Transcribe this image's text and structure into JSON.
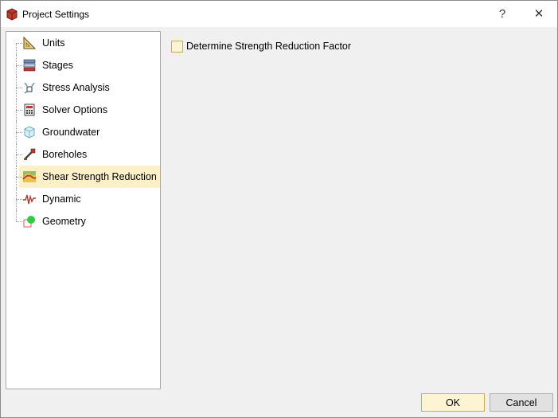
{
  "window": {
    "title": "Project Settings"
  },
  "titlebar": {
    "help_label": "?",
    "close_label": "✕"
  },
  "sidebar": {
    "items": [
      {
        "label": "Units",
        "icon": "units-icon",
        "selected": false
      },
      {
        "label": "Stages",
        "icon": "stages-icon",
        "selected": false
      },
      {
        "label": "Stress Analysis",
        "icon": "stress-analysis-icon",
        "selected": false
      },
      {
        "label": "Solver Options",
        "icon": "solver-options-icon",
        "selected": false
      },
      {
        "label": "Groundwater",
        "icon": "groundwater-icon",
        "selected": false
      },
      {
        "label": "Boreholes",
        "icon": "boreholes-icon",
        "selected": false
      },
      {
        "label": "Shear Strength Reduction",
        "icon": "shear-strength-reduction-icon",
        "selected": true
      },
      {
        "label": "Dynamic",
        "icon": "dynamic-icon",
        "selected": false
      },
      {
        "label": "Geometry",
        "icon": "geometry-icon",
        "selected": false
      }
    ]
  },
  "content": {
    "checkbox_label": "Determine Strength Reduction Factor",
    "checked": false
  },
  "footer": {
    "ok_label": "OK",
    "cancel_label": "Cancel"
  },
  "colors": {
    "selection": "#fcf0c8",
    "accent_border": "#d6a84a"
  }
}
